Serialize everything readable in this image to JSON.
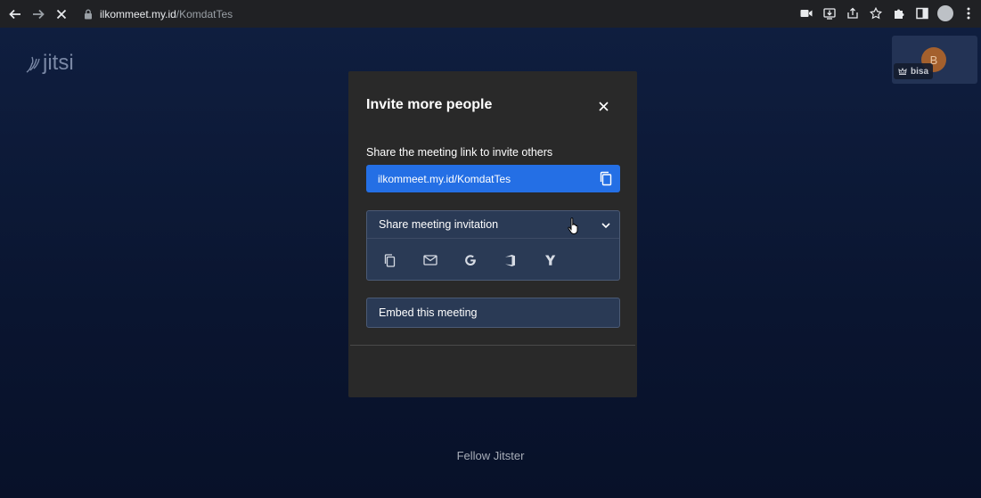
{
  "browser": {
    "url_host": "ilkommeet.my.id",
    "url_path": "/KomdatTes",
    "nav_icons": [
      "back-arrow-icon",
      "forward-arrow-icon",
      "stop-loading-icon"
    ],
    "action_icons": [
      "camera-icon",
      "install-icon",
      "share-icon",
      "star-icon",
      "extensions-icon",
      "side-panel-icon",
      "profile-avatar",
      "menu-icon"
    ]
  },
  "app": {
    "logo_text": "jitsi",
    "participant": {
      "initial": "B",
      "name": "bisa"
    },
    "footer_name": "Fellow Jitster"
  },
  "dialog": {
    "title": "Invite more people",
    "share_label": "Share the meeting link to invite others",
    "link": "ilkommeet.my.id/KomdatTes",
    "share_invitation_label": "Share meeting invitation",
    "share_icons": [
      "copy-icon",
      "email-icon",
      "google-icon",
      "office-icon",
      "yahoo-icon"
    ],
    "embed_label": "Embed this meeting"
  },
  "colors": {
    "accent": "#246fe5",
    "dialog_bg": "#292929",
    "stage_bg": "#0b1530"
  }
}
